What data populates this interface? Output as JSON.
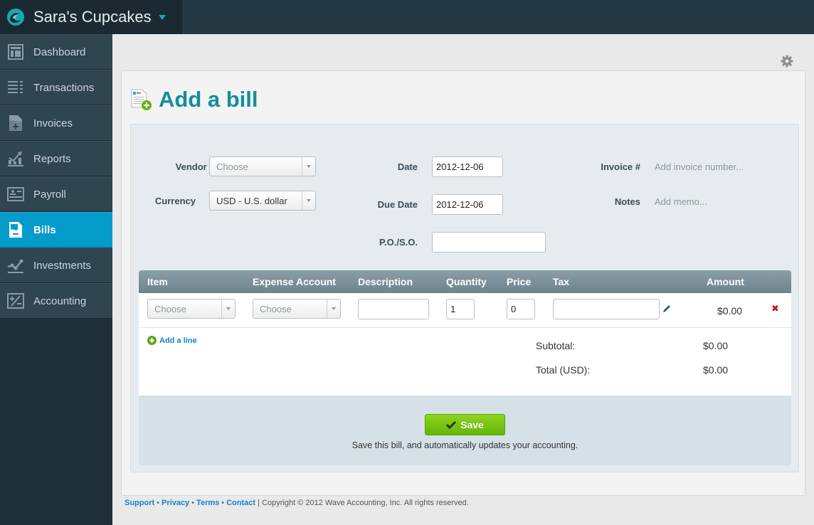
{
  "app": {
    "company_name": "Sara's Cupcakes",
    "brand_color": "#1aa7b3",
    "active_color": "#049bcb"
  },
  "sidebar": {
    "items": [
      {
        "label": "Dashboard",
        "icon": "dashboard-icon",
        "active": false
      },
      {
        "label": "Transactions",
        "icon": "transactions-icon",
        "active": false
      },
      {
        "label": "Invoices",
        "icon": "invoices-icon",
        "active": false
      },
      {
        "label": "Reports",
        "icon": "reports-icon",
        "active": false
      },
      {
        "label": "Payroll",
        "icon": "payroll-icon",
        "active": false
      },
      {
        "label": "Bills",
        "icon": "bills-icon",
        "active": true
      },
      {
        "label": "Investments",
        "icon": "investments-icon",
        "active": false
      },
      {
        "label": "Accounting",
        "icon": "accounting-icon",
        "active": false
      }
    ]
  },
  "page": {
    "title": "Add a bill",
    "settings_icon": "gear-icon"
  },
  "form": {
    "vendor": {
      "label": "Vendor",
      "required_mark": "*",
      "value": "Choose"
    },
    "currency": {
      "label": "Currency",
      "value": "USD - U.S. dollar"
    },
    "date": {
      "label": "Date",
      "value": "2012-12-06"
    },
    "due_date": {
      "label": "Due Date",
      "value": "2012-12-06"
    },
    "po_so": {
      "label": "P.O./S.O.",
      "value": ""
    },
    "invoice_number": {
      "label": "Invoice #",
      "placeholder": "Add invoice number..."
    },
    "notes": {
      "label": "Notes",
      "placeholder": "Add memo..."
    }
  },
  "line_items": {
    "columns": [
      "Item",
      "Expense Account",
      "Description",
      "Quantity",
      "Price",
      "Tax",
      "Amount"
    ],
    "rows": [
      {
        "item": "Choose",
        "expense_account": "Choose",
        "description": "",
        "quantity": "1",
        "price": "0",
        "tax": "",
        "amount": "$0.00"
      }
    ],
    "add_line_label": "Add a line"
  },
  "totals": {
    "subtotal_label": "Subtotal:",
    "subtotal_value": "$0.00",
    "total_label": "Total (USD):",
    "total_value": "$0.00"
  },
  "save": {
    "button_label": "Save",
    "note": "Save this bill, and automatically updates your accounting."
  },
  "footer": {
    "links": [
      "Support",
      "Privacy",
      "Terms",
      "Contact"
    ],
    "separator": "•",
    "copyright": "| Copyright © 2012 Wave Accounting, Inc. All rights reserved."
  }
}
